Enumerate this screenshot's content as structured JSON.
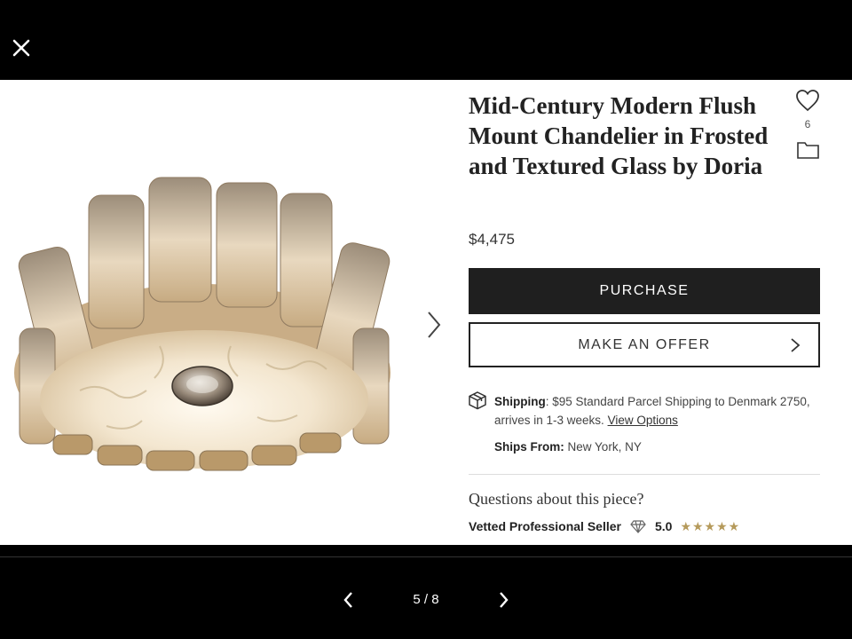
{
  "viewer": {
    "close_icon": "close-icon",
    "counter": "5 / 8",
    "prev_icon": "chevron-left-icon",
    "next_icon": "chevron-right-icon"
  },
  "listing": {
    "title": "Mid-Century Modern Flush Mount Chandelier in Frosted and Textured Glass by Doria",
    "price": "$4,475",
    "favorites_count": "6",
    "purchase_label": "PURCHASE",
    "offer_label": "MAKE AN OFFER",
    "shipping_label": "Shipping",
    "shipping_text": ": $95 Standard Parcel Shipping to Denmark 2750, arrives in 1-3 weeks.",
    "shipping_link": "View Options",
    "ships_from_label": "Ships From:",
    "ships_from_value": "New York, NY",
    "questions": "Questions about this piece?",
    "seller_label": "Vetted Professional Seller",
    "rating": "5.0",
    "stars": "★★★★★"
  },
  "colors": {
    "button_dark": "#1f1f1f",
    "star_gold": "#b59a5b"
  }
}
